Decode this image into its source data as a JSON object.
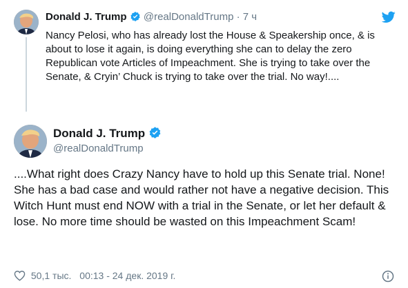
{
  "quoted_tweet": {
    "name": "Donald J. Trump",
    "handle": "@realDonaldTrump",
    "separator": "·",
    "time": "7 ч",
    "text": "Nancy Pelosi, who has already lost the House & Speakership once, & is about to lose it again, is doing everything she can to delay the zero Republican vote Articles of Impeachment. She is trying to take over the Senate, & Cryin’ Chuck is trying to take over the trial. No way!....",
    "verified_icon": "verified-badge-icon"
  },
  "main_tweet": {
    "name": "Donald J. Trump",
    "handle": "@realDonaldTrump",
    "text": "....What right does Crazy Nancy have to hold up this Senate trial. None! She has a bad case and would rather not have a negative decision. This Witch Hunt must end NOW with a trial in the Senate, or let her default & lose. No more time should be wasted on this Impeachment Scam!",
    "verified_icon": "verified-badge-icon",
    "likes": "50,1 тыс.",
    "timestamp": "00:13 - 24 дек. 2019 г."
  },
  "colors": {
    "twitter_blue": "#1da1f2",
    "secondary_text": "#657786",
    "primary_text": "#14171a",
    "thread_line": "#ccd6dd"
  },
  "icons": {
    "logo": "twitter-bird-icon",
    "like": "heart-icon",
    "info": "info-icon"
  }
}
